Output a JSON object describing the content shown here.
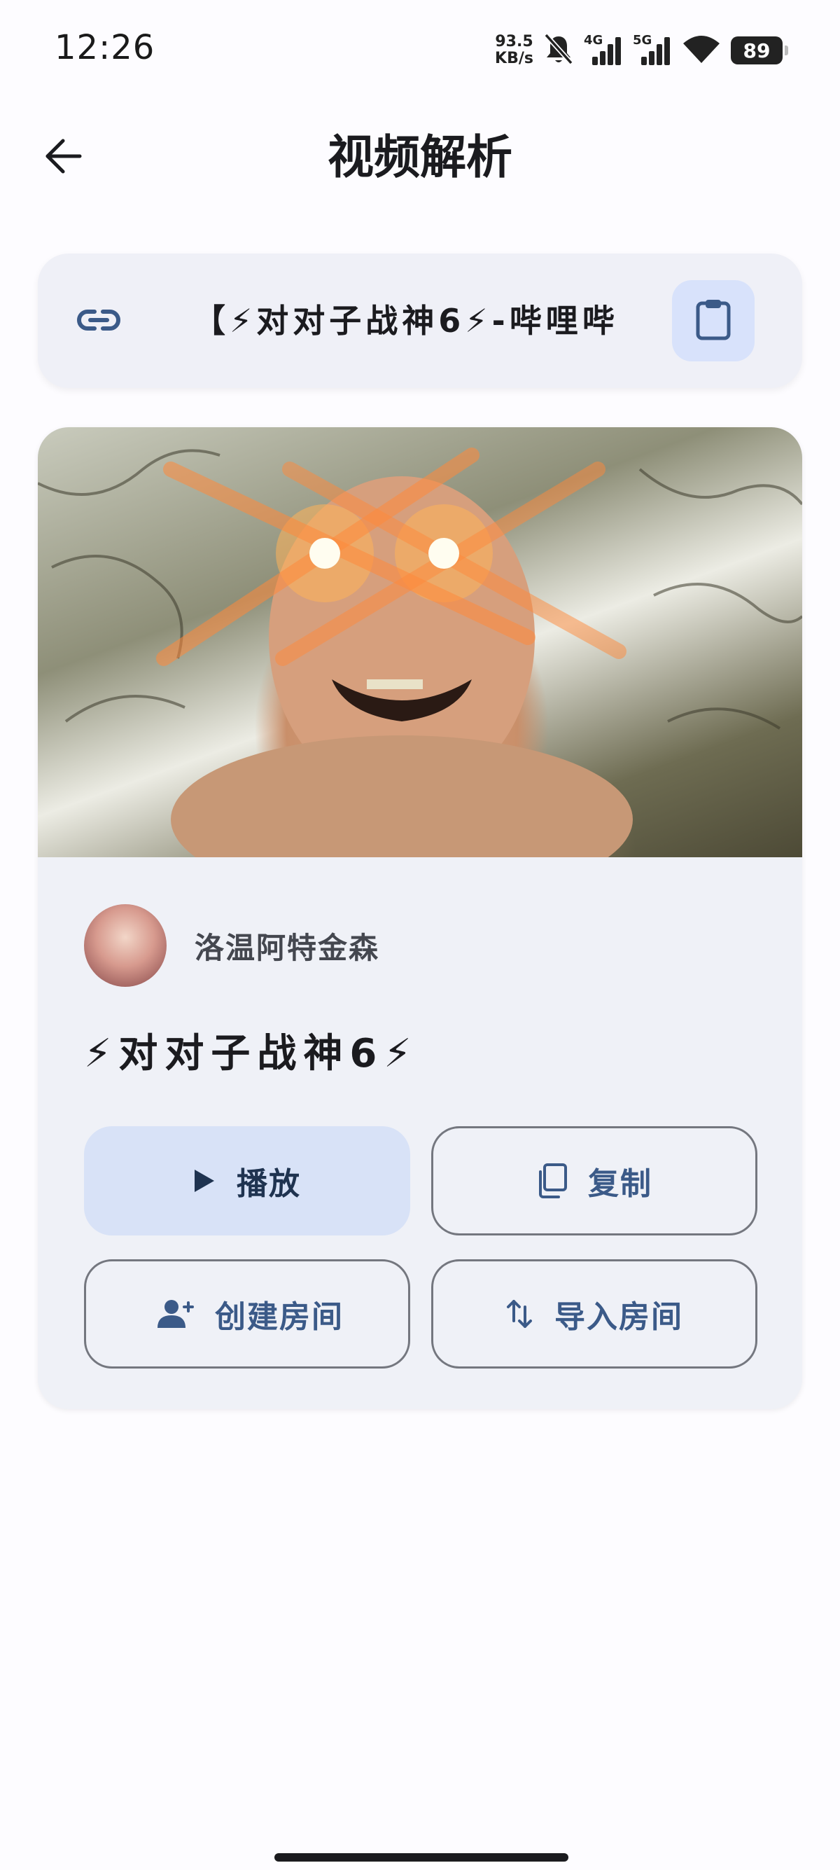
{
  "status_bar": {
    "time": "12:26",
    "net_speed_value": "93.5",
    "net_speed_unit": "KB/s",
    "signal1_gen": "4G",
    "signal2_gen": "5G",
    "battery_level": "89"
  },
  "header": {
    "title": "视频解析",
    "back_icon": "arrow-back-icon"
  },
  "url_input": {
    "value": "【⚡对对子战神6⚡-哔哩哔",
    "link_icon": "link-icon",
    "paste_icon": "clipboard-icon"
  },
  "video": {
    "author": "洛温阿特金森",
    "title": "⚡对对子战神6⚡"
  },
  "actions": {
    "play_label": "播放",
    "copy_label": "复制",
    "create_room_label": "创建房间",
    "import_room_label": "导入房间"
  },
  "colors": {
    "accent": "#3b5a88",
    "tonal_button": "#d8e2f7",
    "card_background": "#eff1f7",
    "outline": "#74777f"
  }
}
